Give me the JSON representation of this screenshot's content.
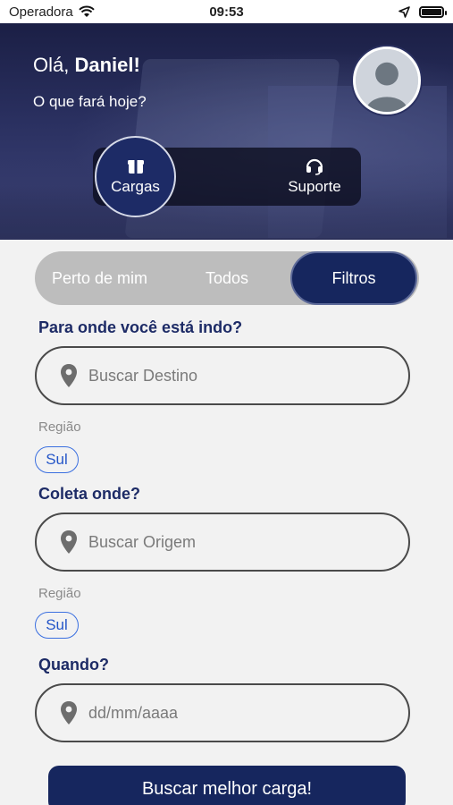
{
  "status_bar": {
    "carrier": "Operadora",
    "time": "09:53"
  },
  "header": {
    "greeting_prefix": "Olá,",
    "user_name": "Daniel!",
    "subtitle": "O que fará hoje?"
  },
  "segment": {
    "items": [
      {
        "label": "Cargas",
        "icon": "box-icon",
        "active": true
      },
      {
        "label": "Suporte",
        "icon": "headset-icon",
        "active": false
      }
    ]
  },
  "tabs": [
    {
      "label": "Perto de mim",
      "active": false
    },
    {
      "label": "Todos",
      "active": false
    },
    {
      "label": "Filtros",
      "active": true
    }
  ],
  "destination": {
    "label": "Para onde você está indo?",
    "placeholder": "Buscar Destino",
    "region_label": "Região",
    "region_chip": "Sul"
  },
  "origin": {
    "label": "Coleta onde?",
    "placeholder": "Buscar Origem",
    "region_label": "Região",
    "region_chip": "Sul"
  },
  "date": {
    "label": "Quando?",
    "placeholder": "dd/mm/aaaa"
  },
  "cta": {
    "label": "Buscar melhor carga!"
  },
  "colors": {
    "primary": "#16265e",
    "chip_blue": "#3a6fe0",
    "tabs_bg": "#bdbdbd"
  }
}
